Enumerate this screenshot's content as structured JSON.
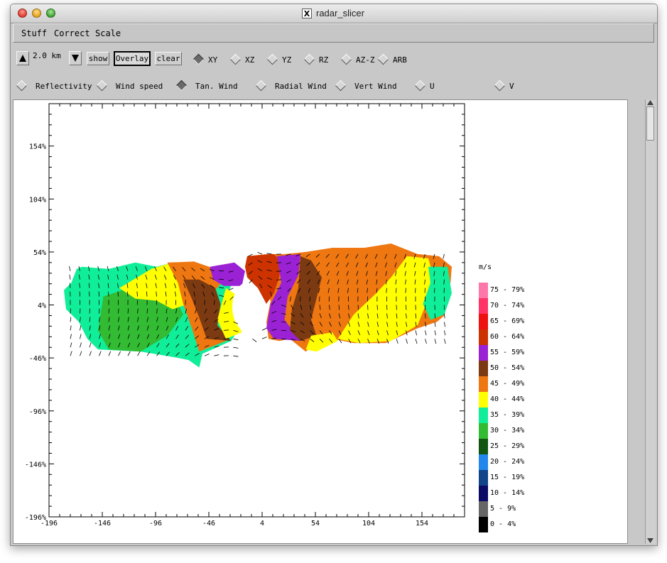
{
  "window": {
    "title": "radar_slicer"
  },
  "menu": {
    "items": [
      "Stuff",
      "Correct",
      "Scale"
    ]
  },
  "toolbar": {
    "level_value": "2.0 km",
    "show_label": "show",
    "overlay_label": "Overlay",
    "clear_label": "clear",
    "plane_options": [
      "XY",
      "XZ",
      "YZ",
      "RZ",
      "AZ-Z",
      "ARB"
    ],
    "plane_selected": "XY",
    "field_options": [
      "Reflectivity",
      "Wind speed",
      "Tan. Wind",
      "Radial Wind",
      "Vert Wind",
      "U",
      "V"
    ],
    "field_selected": "Tan. Wind"
  },
  "chart_data": {
    "type": "heatmap",
    "description_fields": "storm field with wind vectors",
    "x_ticks": [
      "-196",
      "-146",
      "-96",
      "-46",
      "4",
      "54",
      "104",
      "154"
    ],
    "y_ticks": [
      "154",
      "104",
      "54",
      "4",
      "-46",
      "-96",
      "-146",
      "-196"
    ],
    "xlim": [
      -196,
      194
    ],
    "ylim": [
      -196,
      194
    ],
    "legend_unit": "m/s",
    "legend": [
      {
        "label": "75 - 79",
        "color": "#ff77aa"
      },
      {
        "label": "70 - 74",
        "color": "#ff3366"
      },
      {
        "label": "65 - 69",
        "color": "#ee1111"
      },
      {
        "label": "60 - 64",
        "color": "#cc3300"
      },
      {
        "label": "55 - 59",
        "color": "#9b22d4"
      },
      {
        "label": "50 - 54",
        "color": "#7b3a12"
      },
      {
        "label": "45 - 49",
        "color": "#ee7711"
      },
      {
        "label": "40 - 44",
        "color": "#ffff00"
      },
      {
        "label": "35 - 39",
        "color": "#11ee99"
      },
      {
        "label": "30 - 34",
        "color": "#33bb33"
      },
      {
        "label": "25 - 29",
        "color": "#115511"
      },
      {
        "label": "20 - 24",
        "color": "#2288ee"
      },
      {
        "label": "15 - 19",
        "color": "#114488"
      },
      {
        "label": "10 - 14",
        "color": "#0b0b66"
      },
      {
        "label": "5 - 9",
        "color": "#666666"
      },
      {
        "label": "0 - 4",
        "color": "#000000"
      }
    ],
    "legend_suffix": "%"
  }
}
